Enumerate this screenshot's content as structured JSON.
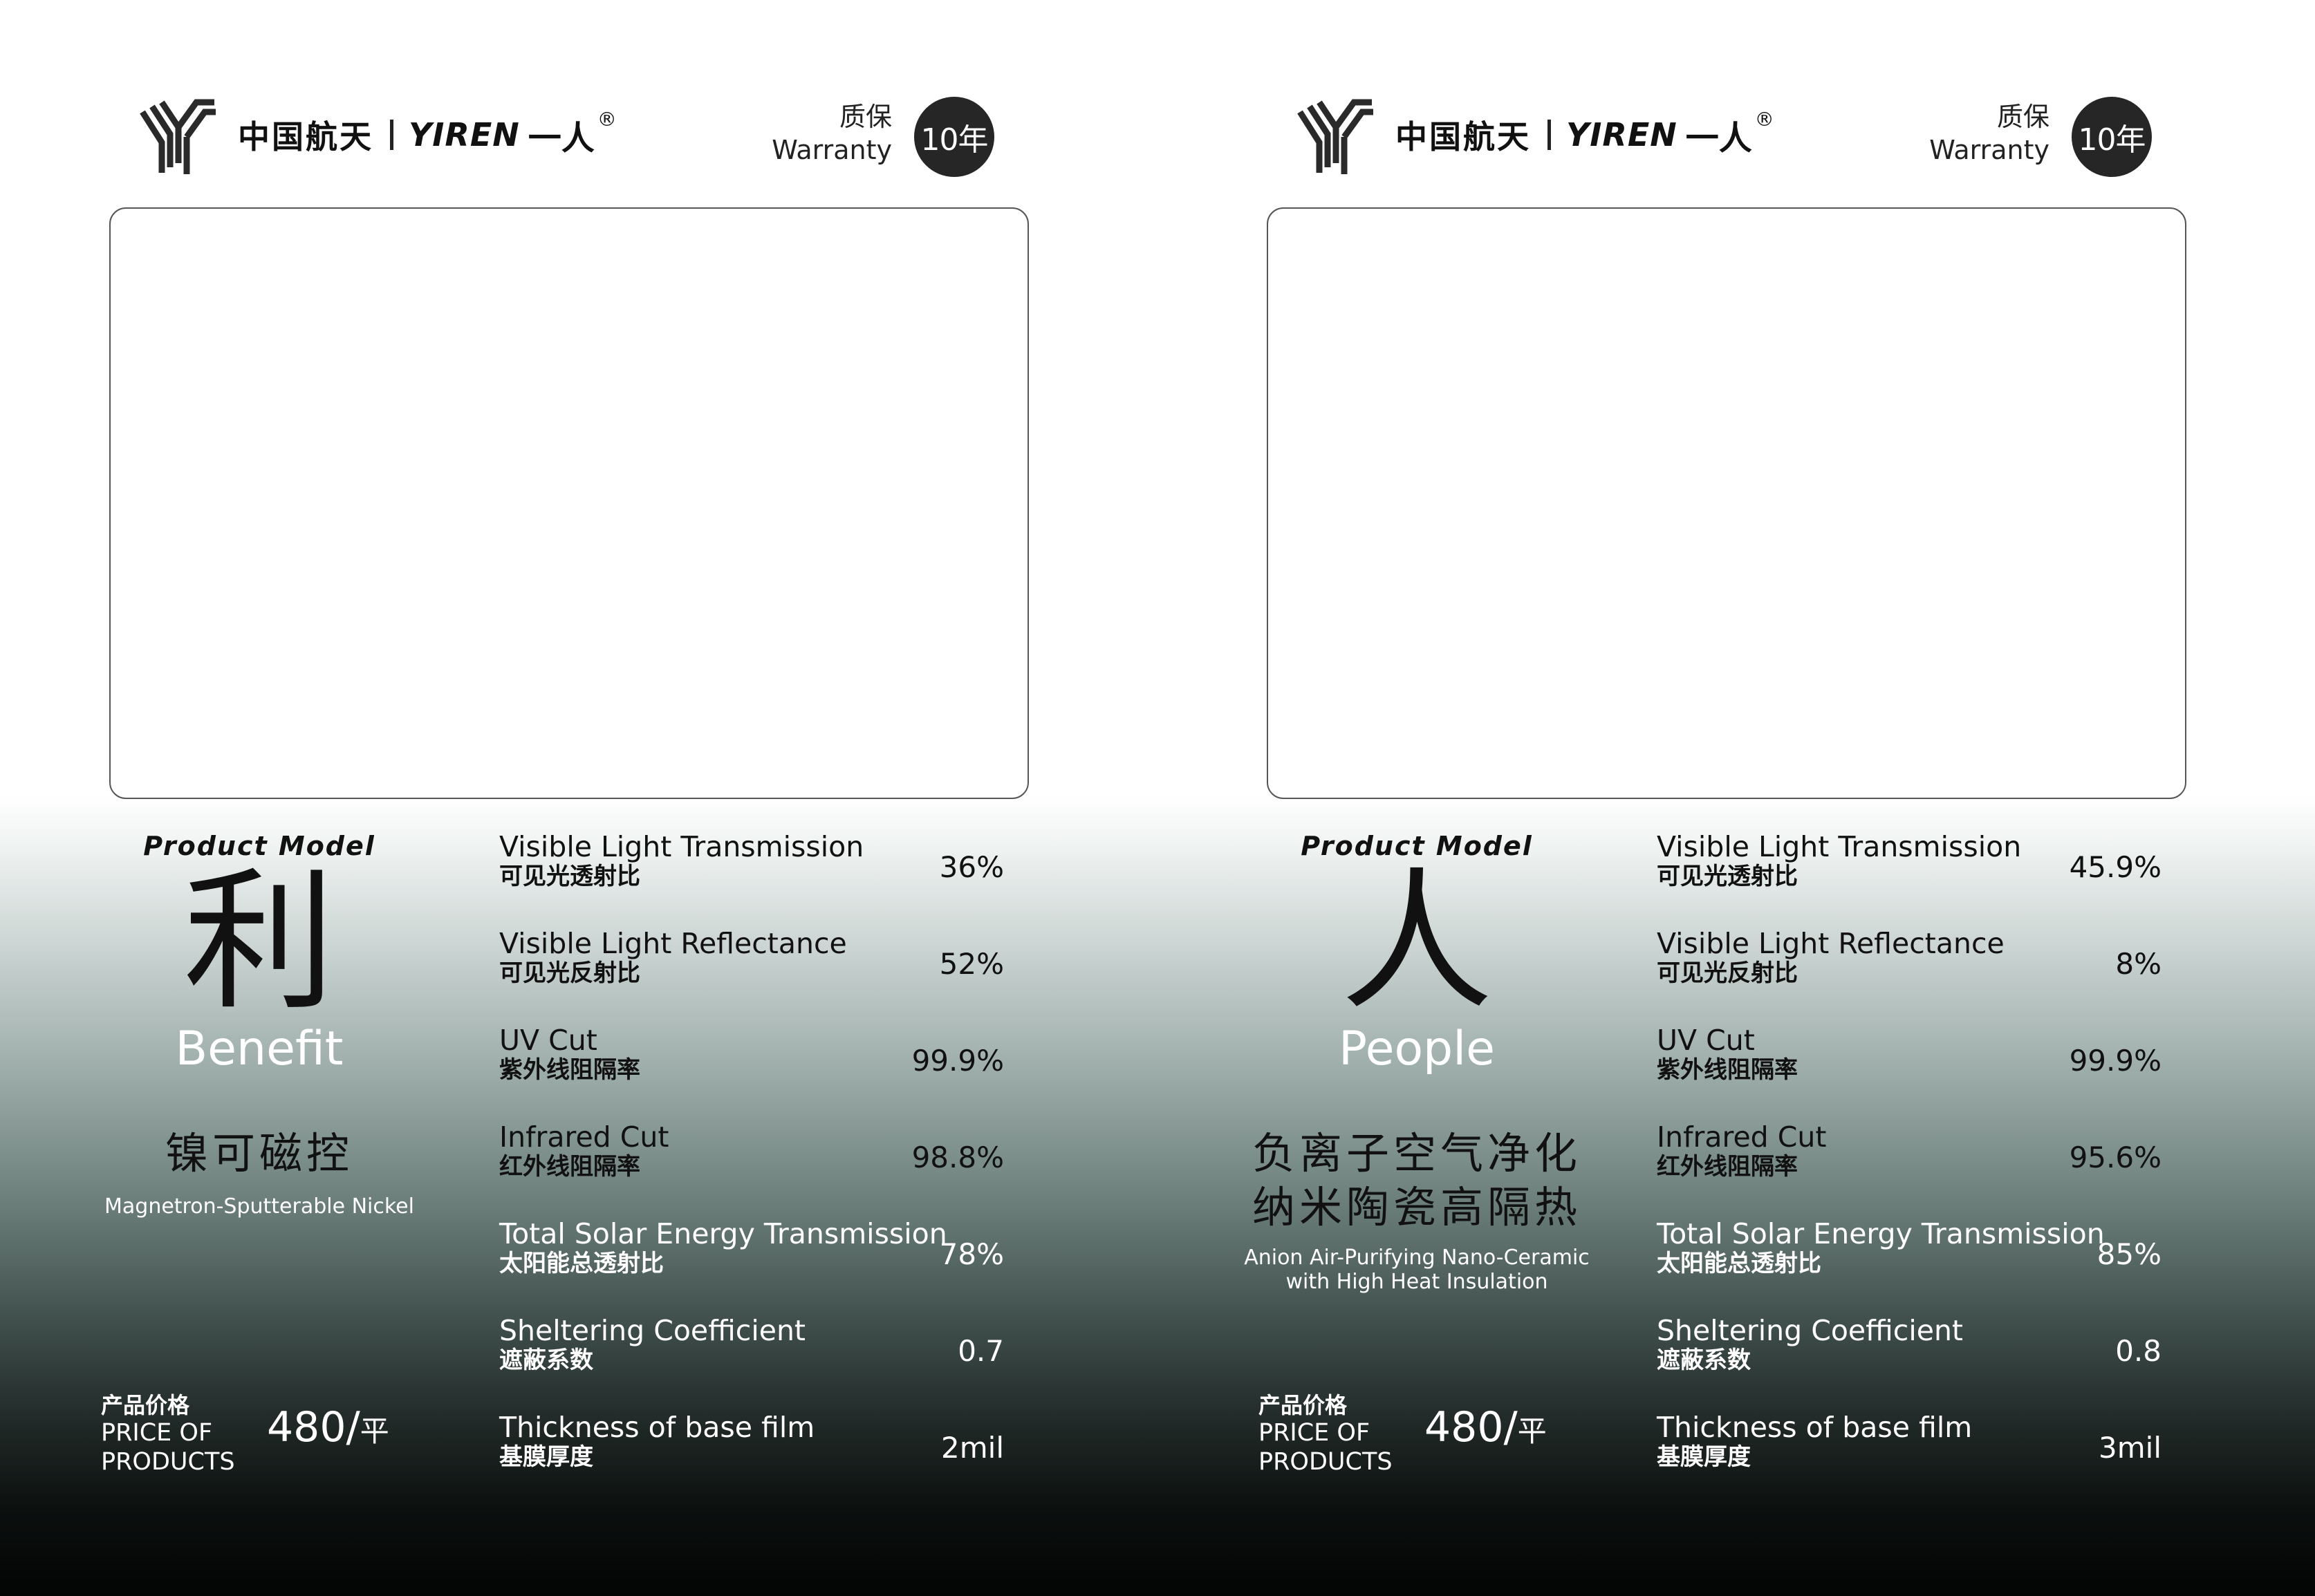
{
  "brand": {
    "name_cn": "中国航天",
    "name_en": "YIREN",
    "name_cn2": "一人",
    "registered": "®"
  },
  "warranty": {
    "label_cn": "质保",
    "label_en": "Warranty",
    "period": "10年"
  },
  "price_label": {
    "cn": "产品价格",
    "en_line1": "PRICE OF",
    "en_line2": "PRODUCTS"
  },
  "cards": [
    {
      "model_label": "Product Model",
      "model_char": "利",
      "model_en": "Benefit",
      "desc_cn": [
        "镍可磁控"
      ],
      "desc_en": "Magnetron-Sputterable Nickel",
      "price": "480/",
      "price_unit": "平",
      "specs": [
        {
          "en": "Visible Light Transmission",
          "cn": "可见光透射比",
          "value": "36%"
        },
        {
          "en": "Visible Light Reflectance",
          "cn": "可见光反射比",
          "value": "52%"
        },
        {
          "en": "UV Cut",
          "cn": "紫外线阻隔率",
          "value": "99.9%"
        },
        {
          "en": "Infrared Cut",
          "cn": "红外线阻隔率",
          "value": "98.8%"
        },
        {
          "en": "Total Solar Energy Transmission",
          "cn": "太阳能总透射比",
          "value": "78%"
        },
        {
          "en": "Sheltering Coefficient",
          "cn": "遮蔽系数",
          "value": "0.7"
        },
        {
          "en": "Thickness of base film",
          "cn": "基膜厚度",
          "value": "2mil"
        }
      ]
    },
    {
      "model_label": "Product Model",
      "model_char": "人",
      "model_en": "People",
      "desc_cn": [
        "负离子空气净化",
        "纳米陶瓷高隔热"
      ],
      "desc_en": "Anion Air-Purifying Nano-Ceramic with High Heat Insulation",
      "price": "480/",
      "price_unit": "平",
      "specs": [
        {
          "en": "Visible Light Transmission",
          "cn": "可见光透射比",
          "value": "45.9%"
        },
        {
          "en": "Visible Light Reflectance",
          "cn": "可见光反射比",
          "value": "8%"
        },
        {
          "en": "UV Cut",
          "cn": "紫外线阻隔率",
          "value": "99.9%"
        },
        {
          "en": "Infrared Cut",
          "cn": "红外线阻隔率",
          "value": "95.6%"
        },
        {
          "en": "Total Solar Energy Transmission",
          "cn": "太阳能总透射比",
          "value": "85%"
        },
        {
          "en": "Sheltering Coefficient",
          "cn": "遮蔽系数",
          "value": "0.8"
        },
        {
          "en": "Thickness of base film",
          "cn": "基膜厚度",
          "value": "3mil"
        }
      ]
    }
  ]
}
